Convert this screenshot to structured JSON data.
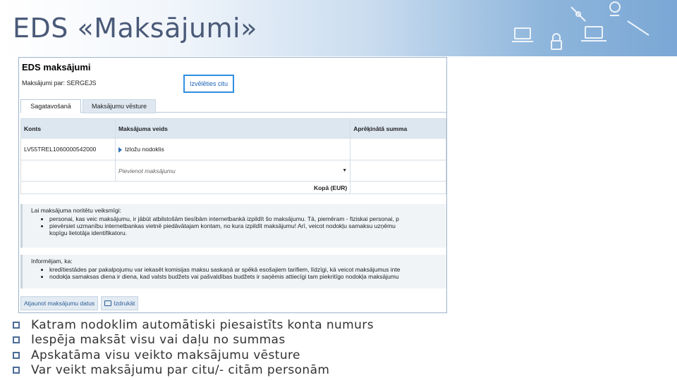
{
  "slide": {
    "title": "EDS «Maksājumi»",
    "bullets": [
      "Katram nodoklim automātiski piesaistīts konta numurs",
      "Iespēja maksāt visu vai daļu no summas",
      "Apskatāma visu veikto maksājumu vēsture",
      "Var veikt maksājumu par citu/- citām personām"
    ]
  },
  "app": {
    "title": "EDS maksājumi",
    "subtitle": "Maksājumi par: SERGEJS",
    "choose_other": "Izvēlēties citu",
    "tabs": [
      "Sagatavošanā",
      "Maksājumu vēsture"
    ],
    "table": {
      "headers": [
        "Konts",
        "Maksājuma veids",
        "Aprēķinātā summa"
      ],
      "row1": [
        "LV55TREL1060000542000",
        "Izložu nodoklis",
        ""
      ],
      "select_placeholder": "Pievienot maksājumu",
      "total_label": "Kopā (EUR)"
    },
    "info1": {
      "lead": "Lai maksājuma noritētu veiksmīgi:",
      "items": [
        "personai, kas veic maksājumu, ir jābūt atbilstošām tiesībām internetbankā izpildīt šo maksājumu. Tā, piemēram - fiziskai personai, p",
        "pievērsiet uzmanību internetbankas vietnē piedāvātajam kontam, no kura izpildīt maksājumu! Arī, veicot nodokļu samaksu uzņēmu",
        "kopīgu lietotāja identifikatoru."
      ]
    },
    "info2": {
      "lead": "Informējam, ka:",
      "items": [
        "kredītiestādes par pakalpojumu var iekasēt komisijas maksu saskaņā ar spēkā esošajiem tarifiem, līdzīgi, kā veicot maksājumus inte",
        "nodokļa samaksas diena ir diena, kad valsts budžets vai pašvaldības budžets ir saņēmis attiecīgi tam piekritīgo nodokļa maksājumu"
      ]
    },
    "actions": {
      "refresh": "Atjaunot maksājumu datus",
      "print": "Izdrukāt"
    }
  },
  "colors": {
    "accent": "#2f8fe0",
    "title_text": "#4a5a78",
    "bullet_box": "#4a6c95"
  }
}
